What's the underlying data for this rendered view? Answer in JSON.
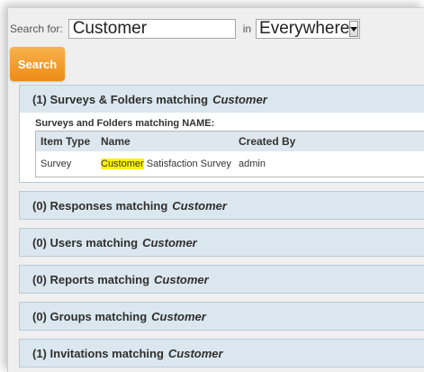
{
  "search": {
    "label": "Search for:",
    "value": "Customer",
    "in_label": "in",
    "scope": "Everywhere",
    "button_label": "Search"
  },
  "results": {
    "surveys": {
      "count": "(1)",
      "title": "Surveys & Folders matching",
      "term": "Customer",
      "subheading": "Surveys and Folders matching NAME:",
      "columns": [
        "Item Type",
        "Name",
        "Created By"
      ],
      "rows": [
        {
          "type": "Survey",
          "name_match": "Customer",
          "name_rest": " Satisfaction Survey",
          "created_by": "admin"
        }
      ]
    },
    "responses": {
      "count": "(0)",
      "title": "Responses matching",
      "term": "Customer"
    },
    "users": {
      "count": "(0)",
      "title": "Users matching",
      "term": "Customer"
    },
    "reports": {
      "count": "(0)",
      "title": "Reports matching",
      "term": "Customer"
    },
    "groups": {
      "count": "(0)",
      "title": "Groups matching",
      "term": "Customer"
    },
    "invitations": {
      "count": "(1)",
      "title": "Invitations matching",
      "term": "Customer"
    }
  },
  "colors": {
    "accent": "#ef8f1a",
    "section_bg": "#dbe7ee",
    "highlight": "#fff200"
  },
  "icons": {
    "dropdown": "chevron-down-icon"
  }
}
